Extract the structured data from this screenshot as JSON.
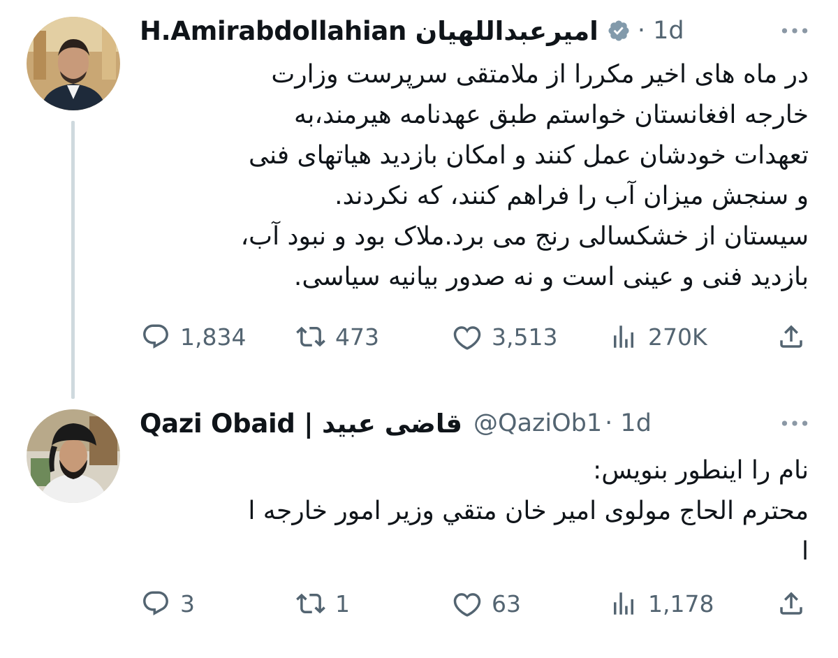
{
  "tweets": [
    {
      "display_name": "H.Amirabdollahian امیرعبداللهیان",
      "verified": true,
      "handle": "",
      "time": "· 1d",
      "text_lines": [
        "در ماه های اخیر مکررا از ملامتقی سرپرست وزارت",
        "خارجه افغانستان خواستم طبق عهدنامه هیرمند،به",
        "تعهدات خودشان عمل کنند و امکان بازدید هیاتهای فنی",
        "و سنجش میزان آب را فراهم کنند، که نکردند.",
        "سیستان از خشکسالی رنج می برد.ملاک بود و نبود آب،",
        "بازدید فنی و عینی است و نه صدور بیانیه سیاسی."
      ],
      "stats": {
        "replies": "1,834",
        "retweets": "473",
        "likes": "3,513",
        "views": "270K"
      }
    },
    {
      "display_name": "Qazi Obaid | قاضی عبید",
      "verified": false,
      "handle": "@QaziOb1",
      "time": "· 1d",
      "text_lines": [
        "نام را اینطور بنویس:",
        "محترم الحاج مولوی امیر خان متقي وزیر امور خارجه ا",
        "ا"
      ],
      "stats": {
        "replies": "3",
        "retweets": "1",
        "likes": "63",
        "views": "1,178"
      }
    }
  ],
  "icons": {
    "reply": "reply-icon",
    "retweet": "retweet-icon",
    "like": "heart-icon",
    "views": "views-icon",
    "share": "share-icon",
    "more": "more-icon",
    "verified": "verified-badge-icon"
  },
  "colors": {
    "text": "#0f1419",
    "secondary": "#536471",
    "thread_line": "#cfd9de"
  }
}
